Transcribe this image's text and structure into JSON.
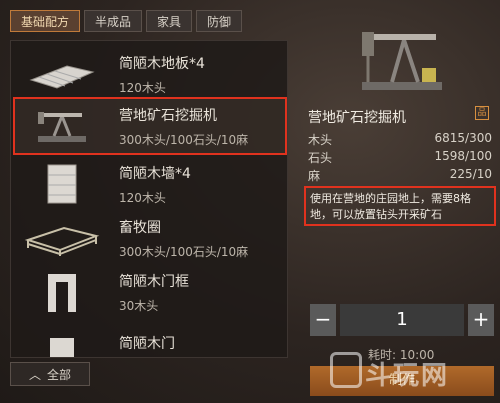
{
  "tabs": [
    "基础配方",
    "半成品",
    "家具",
    "防御"
  ],
  "items": [
    {
      "name": "简陋木地板*4",
      "cost": "120木头"
    },
    {
      "name": "营地矿石挖掘机",
      "cost": "300木头/100石头/10麻"
    },
    {
      "name": "简陋木墙*4",
      "cost": "120木头"
    },
    {
      "name": "畜牧圈",
      "cost": "300木头/100石头/10麻"
    },
    {
      "name": "简陋木门框",
      "cost": "30木头"
    },
    {
      "name": "简陋木门",
      "cost": ""
    }
  ],
  "footer": {
    "label": "全部",
    "icon": "chevron-up-icon"
  },
  "detail": {
    "title": "营地矿石挖掘机",
    "badge": "品",
    "resources": [
      {
        "label": "木头",
        "value": "6815/300"
      },
      {
        "label": "石头",
        "value": "1598/100"
      },
      {
        "label": "麻",
        "value": "225/10"
      }
    ],
    "description": "使用在营地的庄园地上，需要8格地，可以放置钻头开采矿石",
    "quantity": "1",
    "minus": "−",
    "plus": "+",
    "time": "耗时: 10:00",
    "make_label": "制作"
  },
  "watermark": "斗玩网"
}
